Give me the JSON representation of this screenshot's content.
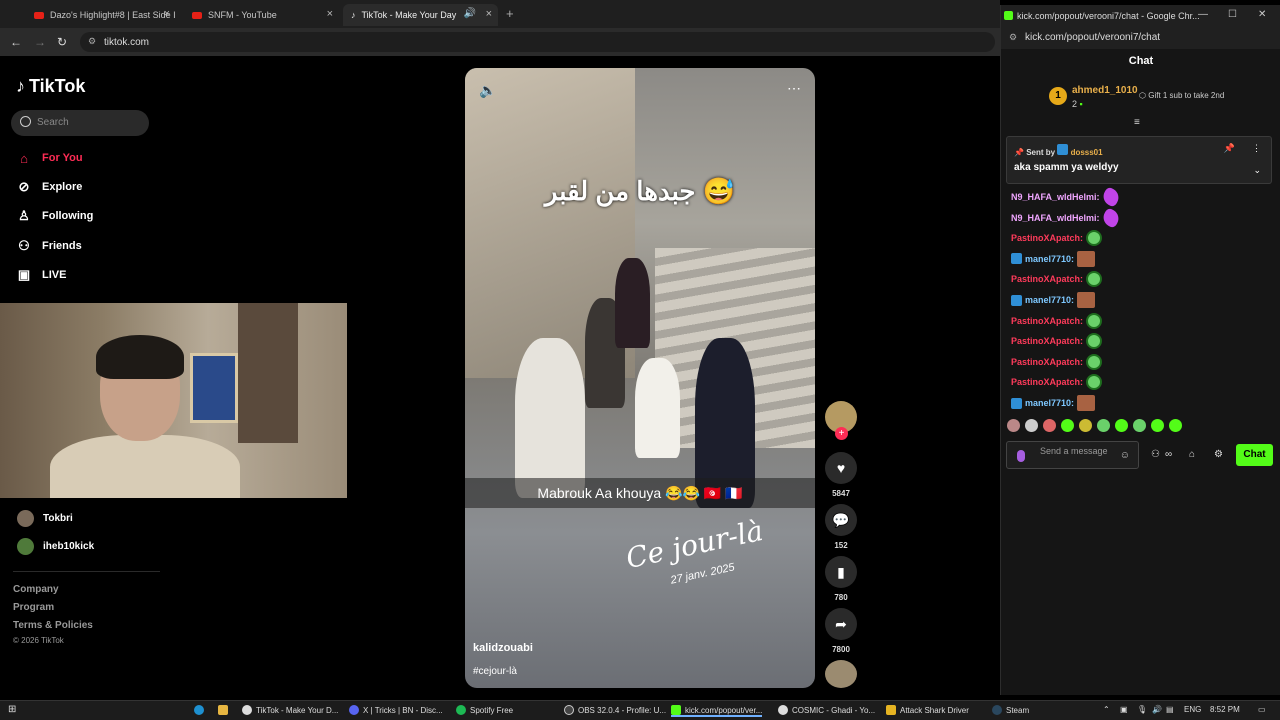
{
  "browser": {
    "tabs": [
      {
        "title": "Dazo's Highlight#8 | East Side I"
      },
      {
        "title": "SNFM - YouTube"
      },
      {
        "title": "TikTok - Make Your Day"
      }
    ],
    "url": "tiktok.com"
  },
  "tiktok": {
    "logo": "TikTok",
    "search_placeholder": "Search",
    "nav": [
      {
        "label": "For You",
        "icon": "home-icon",
        "active": true
      },
      {
        "label": "Explore",
        "icon": "compass-icon"
      },
      {
        "label": "Following",
        "icon": "following-icon"
      },
      {
        "label": "Friends",
        "icon": "friends-icon"
      },
      {
        "label": "LIVE",
        "icon": "live-icon"
      }
    ],
    "following_accounts": [
      "Tokbri",
      "iheb10kick"
    ],
    "footer": [
      "Company",
      "Program",
      "Terms & Policies"
    ],
    "copyright": "© 2026 TikTok",
    "video": {
      "overlay_arabic": "جبدها من لقبر 😅",
      "caption": "Mabrouk Aa khouya 😂😂 🇹🇳 🇫🇷",
      "overlay_cejour": "Ce jour-là",
      "overlay_date": "27 janv. 2025",
      "username": "kalidzouabi",
      "hashtag": "#cejour-là"
    },
    "actions": {
      "likes": "5847",
      "comments": "152",
      "saves": "780",
      "shares": "7800"
    }
  },
  "chat_popup": {
    "window_title": "kick.com/popout/verooni7/chat - Google Chr...",
    "url": "kick.com/popout/verooni7/chat",
    "header": "Chat",
    "leaderboard": {
      "rank": "1",
      "name": "ahmed1_1010",
      "count": "2",
      "gift_text": "Gift 1 sub to take 2nd"
    },
    "pinned": {
      "sent_by_label": "Sent by",
      "sender": "dosss01",
      "message": "aka spamm ya weldyy"
    },
    "messages": [
      {
        "user": "N9_HAFA_wldHelmi:",
        "color": "#f0a6ff",
        "emote": "purple"
      },
      {
        "user": "N9_HAFA_wldHelmi:",
        "color": "#f0a6ff",
        "emote": "purple"
      },
      {
        "user": "PastinoXApatch:",
        "color": "#ff3b5b",
        "emote": "green"
      },
      {
        "user": "manel7710:",
        "color": "#7ec8ff",
        "emote": "face",
        "badge": true
      },
      {
        "user": "PastinoXApatch:",
        "color": "#ff3b5b",
        "emote": "green"
      },
      {
        "user": "manel7710:",
        "color": "#7ec8ff",
        "emote": "face",
        "badge": true
      },
      {
        "user": "PastinoXApatch:",
        "color": "#ff3b5b",
        "emote": "green"
      },
      {
        "user": "PastinoXApatch:",
        "color": "#ff3b5b",
        "emote": "green"
      },
      {
        "user": "PastinoXApatch:",
        "color": "#ff3b5b",
        "emote": "green"
      },
      {
        "user": "PastinoXApatch:",
        "color": "#ff3b5b",
        "emote": "green"
      },
      {
        "user": "manel7710:",
        "color": "#7ec8ff",
        "emote": "face",
        "badge": true
      }
    ],
    "input_placeholder": "Send a message",
    "send_label": "Chat"
  },
  "taskbar": {
    "apps": [
      {
        "label": "TikTok - Make Your D..."
      },
      {
        "label": "X | Tricks | BN - Disc..."
      },
      {
        "label": "Spotify Free"
      },
      {
        "label": "OBS 32.0.4 - Profile: U..."
      },
      {
        "label": "kick.com/popout/ver..."
      },
      {
        "label": "COSMIC - Ghadi - Yo..."
      },
      {
        "label": "Attack Shark Driver"
      },
      {
        "label": "Steam"
      }
    ],
    "language": "ENG",
    "time": "8:52 PM"
  }
}
